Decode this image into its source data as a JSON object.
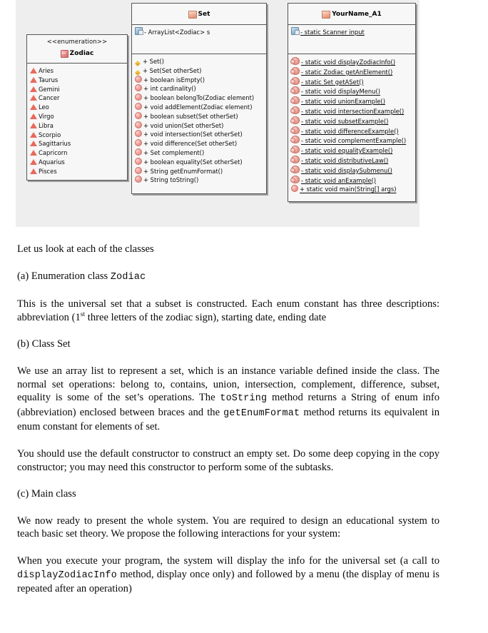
{
  "diagram": {
    "zodiac": {
      "stereotype": "<<enumeration>>",
      "title": "Zodiac",
      "constants": [
        "Aries",
        "Taurus",
        "Gemini",
        "Cancer",
        "Leo",
        "Virgo",
        "Libra",
        "Scorpio",
        "Sagittarius",
        "Capricorn",
        "Aquarius",
        "Pisces"
      ]
    },
    "set": {
      "title": "Set",
      "fields": [
        "- ArrayList<Zodiac> s"
      ],
      "methods": [
        {
          "kind": "ctor",
          "text": "+ Set()"
        },
        {
          "kind": "ctor",
          "text": "+ Set(Set otherSet)"
        },
        {
          "kind": "method",
          "text": "+ boolean isEmpty()"
        },
        {
          "kind": "method",
          "text": "+ int cardinality()"
        },
        {
          "kind": "method",
          "text": "+ boolean belongTo(Zodiac element)"
        },
        {
          "kind": "method",
          "text": "+ void addElement(Zodiac element)"
        },
        {
          "kind": "method",
          "text": "+ boolean subset(Set otherSet)"
        },
        {
          "kind": "method",
          "text": "+ void union(Set otherSet)"
        },
        {
          "kind": "method",
          "text": "+ void intersection(Set otherSet)"
        },
        {
          "kind": "method",
          "text": "+ void difference(Set otherSet)"
        },
        {
          "kind": "method",
          "text": "+ Set complement()"
        },
        {
          "kind": "method",
          "text": "+ boolean equality(Set otherSet)"
        },
        {
          "kind": "method",
          "text": "+ String getEnumFormat()"
        },
        {
          "kind": "method",
          "text": "+ String toString()"
        }
      ]
    },
    "main_class": {
      "title": "YourName_A1",
      "fields": [
        "- static Scanner input"
      ],
      "methods": [
        {
          "kind": "static",
          "text": "- static void displayZodiacInfo()"
        },
        {
          "kind": "static",
          "text": "- static Zodiac getAnElement()"
        },
        {
          "kind": "static",
          "text": "- static Set getASet()"
        },
        {
          "kind": "static",
          "text": "- static void displayMenu()"
        },
        {
          "kind": "static",
          "text": "- static void unionExample()"
        },
        {
          "kind": "static",
          "text": "- static void intersectionExample()"
        },
        {
          "kind": "static",
          "text": "- static void subsetExample()"
        },
        {
          "kind": "static",
          "text": "- static void differenceExample()"
        },
        {
          "kind": "static",
          "text": "- static void complementExample()"
        },
        {
          "kind": "static",
          "text": "- static void equalityExample()"
        },
        {
          "kind": "static",
          "text": "- static void distributiveLaw()"
        },
        {
          "kind": "static",
          "text": "- static void displaySubmenu()"
        },
        {
          "kind": "static",
          "text": "- static void anExample()"
        },
        {
          "kind": "public",
          "text": "+ static void main(String[] args)"
        }
      ]
    }
  },
  "body": {
    "intro": "Let us look at each of the classes",
    "heading_a_prefix": "(a) Enumeration class ",
    "heading_a_code": "Zodiac",
    "para_a_1": "This is the universal set that a subset is constructed. Each enum constant has three descriptions: abbreviation (1",
    "para_a_sup": "st",
    "para_a_2": " three letters of the zodiac sign), starting date, ending date",
    "heading_b": "(b) Class Set",
    "para_b_1": "We use an array list to represent a set, which is an instance variable defined inside the class. The normal set operations: belong to, contains, union, intersection, complement, difference, subset, equality is some of the set’s operations. The ",
    "para_b_code1": "toString",
    "para_b_2": " method returns a String of enum info (abbreviation) enclosed between braces and the ",
    "para_b_code2": "getEnumFormat",
    "para_b_3": " method returns its equivalent in enum constant for elements of set.",
    "para_b2": "You should use the default constructor to construct an empty set. Do some deep copying in the copy constructor; you may need this constructor to perform some of the subtasks.",
    "heading_c": "(c) Main class",
    "para_c1": "We now ready to present the whole system. You are required to design an educational system to teach basic set theory. We propose the following interactions for your system:",
    "para_c2_1": "When you execute your program, the system will display the info for the universal set (a call to ",
    "para_c2_code": "displayZodiacInfo",
    "para_c2_2": " method, display once only) and followed by a menu (the display of menu is repeated after an operation)"
  }
}
